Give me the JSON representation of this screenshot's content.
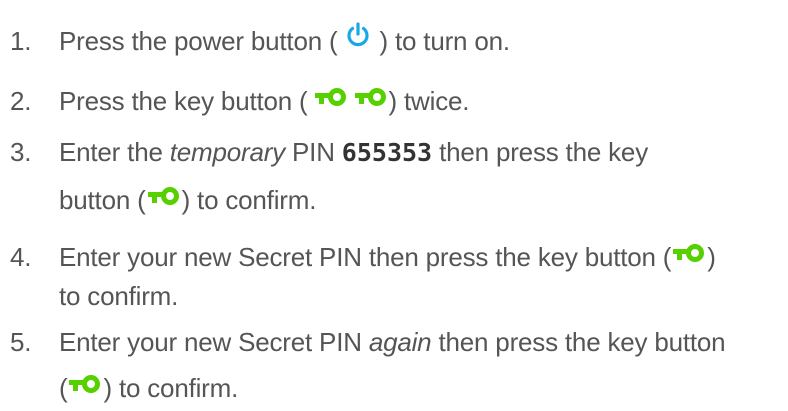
{
  "steps": [
    {
      "num": "1.",
      "lines": [
        [
          "Press the power button ( ",
          " ) to turn on."
        ]
      ],
      "icons": [
        "power-icon"
      ]
    },
    {
      "num": "2.",
      "lines": [
        [
          "Press the key button ( ",
          ") twice."
        ]
      ],
      "icons": [
        "key-icon",
        "key-icon"
      ]
    },
    {
      "num": "3.",
      "text_before": "Enter the ",
      "emph": "temporary",
      "text_mid": " PIN ",
      "pin": "655353",
      "text_after": " then press the key",
      "line2_before": "button (",
      "line2_after": ") to confirm.",
      "icons": [
        "key-icon"
      ]
    },
    {
      "num": "4.",
      "line1_before": "Enter your new Secret PIN then press the key button (",
      "line1_after": ")",
      "line2": "to confirm.",
      "icons": [
        "key-icon"
      ]
    },
    {
      "num": "5.",
      "line1_before": "Enter your new Secret PIN ",
      "emph": "again",
      "line1_after": " then press the key button",
      "line2_before": "(",
      "line2_after": ") to confirm.",
      "icons": [
        "key-icon"
      ]
    }
  ],
  "colors": {
    "text": "#555555",
    "power_icon": "#1aa7e8",
    "key_icon": "#57d000"
  }
}
